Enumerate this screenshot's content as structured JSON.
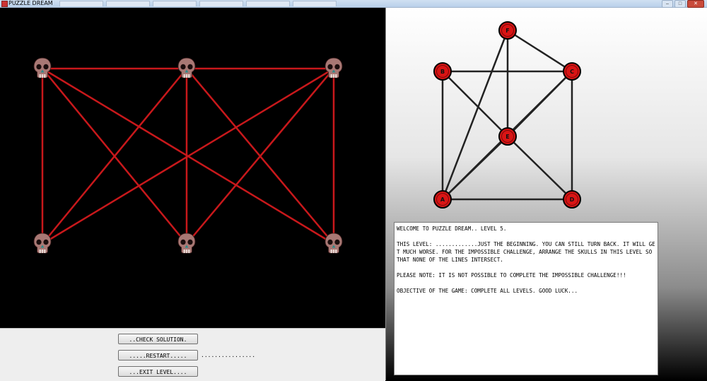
{
  "window": {
    "title": "PUZZLE DREAM",
    "buttons": {
      "minimize": "–",
      "maximize": "□",
      "close": "✕"
    }
  },
  "board": {
    "skull_icon": "skull-icon",
    "skulls": [
      {
        "id": "top-left"
      },
      {
        "id": "top-middle"
      },
      {
        "id": "top-right"
      },
      {
        "id": "bottom-left"
      },
      {
        "id": "bottom-middle"
      },
      {
        "id": "bottom-right"
      }
    ],
    "line_color": "#c8181b"
  },
  "controls": {
    "check_label": "..CHECK SOLUTION.",
    "restart_label": ".....RESTART.....",
    "exit_label": "...EXIT LEVEL....",
    "status_text": "................"
  },
  "preview": {
    "node_color": "#d91414",
    "nodes": [
      "F",
      "B",
      "C",
      "E",
      "A",
      "D"
    ]
  },
  "info": {
    "welcome": "WELCOME TO PUZZLE DREAM.. LEVEL 5.",
    "level_text": "THIS LEVEL: .............JUST THE BEGINNING. YOU CAN STILL TURN BACK. IT WILL GET MUCH WORSE. FOR THE IMPOSSIBLE CHALLENGE, ARRANGE THE SKULLS IN THIS LEVEL SO THAT NONE OF THE LINES INTERSECT.",
    "note": "PLEASE NOTE: IT IS NOT POSSIBLE TO COMPLETE THE IMPOSSIBLE CHALLENGE!!!",
    "objective": "OBJECTIVE OF THE GAME: COMPLETE ALL LEVELS. GOOD LUCK..."
  }
}
